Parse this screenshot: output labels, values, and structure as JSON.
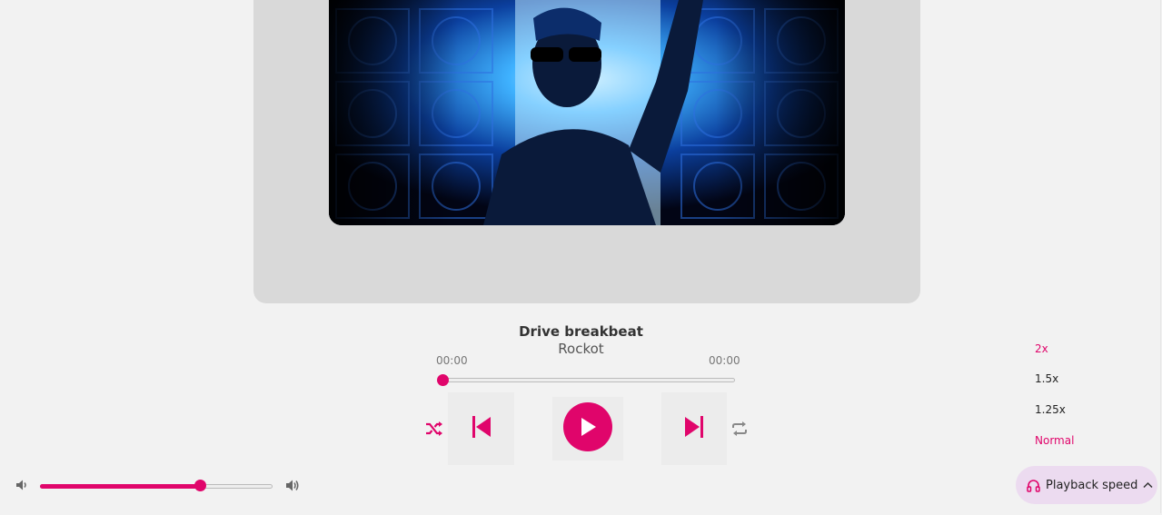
{
  "track": {
    "title": "Drive breakbeat",
    "artist": "Rockot",
    "current_time": "00:00",
    "duration": "00:00",
    "progress": 0
  },
  "controls": {
    "shuffle_icon": "shuffle-icon",
    "prev_icon": "skip-previous-icon",
    "play_icon": "play-icon",
    "next_icon": "skip-next-icon",
    "repeat_icon": "repeat-icon"
  },
  "volume": {
    "level": 0.69,
    "low_icon": "volume-low-icon",
    "high_icon": "volume-high-icon"
  },
  "playback_speed": {
    "label": "Playback speed",
    "options": [
      "2x",
      "1.5x",
      "1.25x",
      "Normal"
    ],
    "icon": "headphones-icon",
    "chevron": "chevron-up-icon"
  },
  "colors": {
    "accent": "#e0056b",
    "speed_button_bg": "#ecdbf0"
  }
}
